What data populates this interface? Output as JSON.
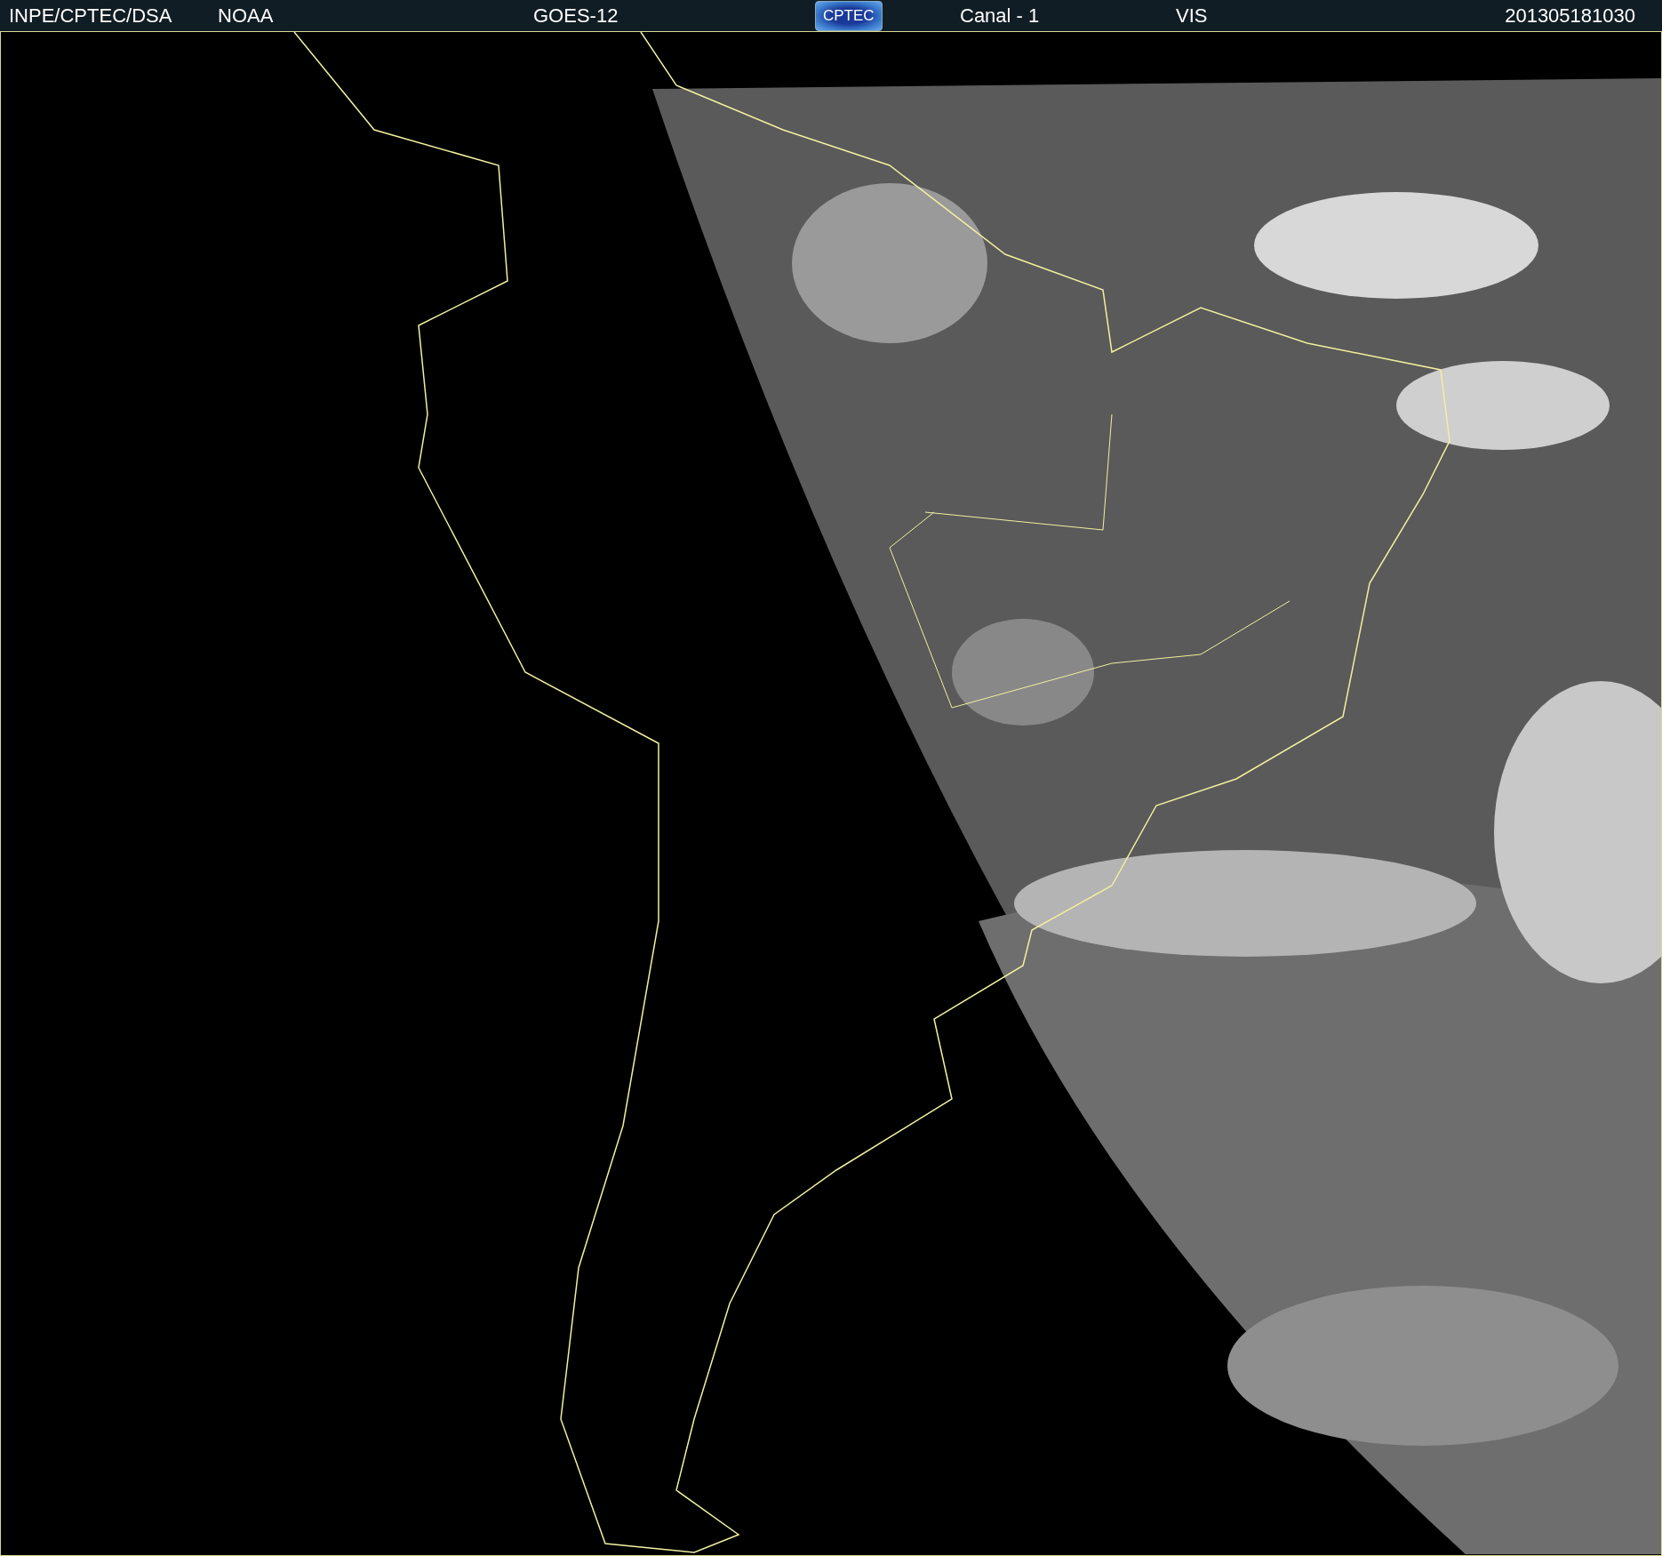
{
  "header": {
    "items": [
      {
        "kind": "text",
        "text": "INPE/CPTEC/DSA"
      },
      {
        "kind": "text",
        "text": "NOAA"
      },
      {
        "kind": "text",
        "text": "GOES-12"
      },
      {
        "kind": "logo",
        "text": "CPTEC"
      },
      {
        "kind": "text",
        "text": "Canal - 1"
      },
      {
        "kind": "text",
        "text": "VIS"
      },
      {
        "kind": "text",
        "text": "201305181030"
      }
    ]
  }
}
